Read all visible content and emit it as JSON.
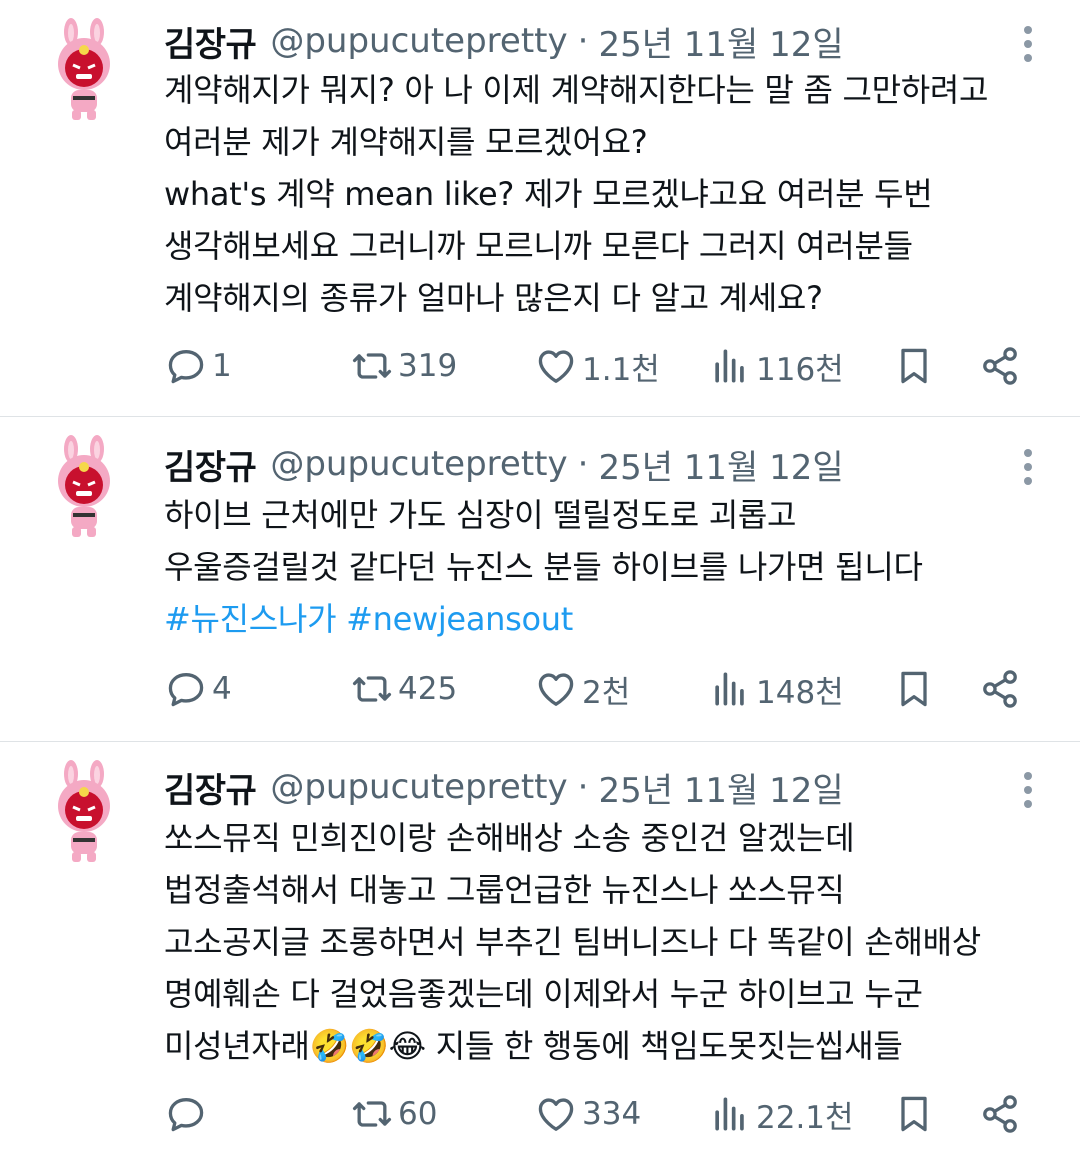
{
  "tweets": [
    {
      "name": "김장규",
      "handle": "@pupucutepretty",
      "separator": "·",
      "date": "25년 11월 12일",
      "lines": [
        "계약해지가 뭐지? 아 나 이제 계약해지한다는 말 좀 그만하려고",
        "여러분 제가 계약해지를 모르겠어요?",
        "what's 계약 mean like? 제가 모르겠냐고요 여러분 두번",
        "생각해보세요 그러니까 모르니까 모른다 그러지 여러분들",
        "계약해지의 종류가 얼마나 많은지 다 알고 계세요?"
      ],
      "stats": {
        "replies": "1",
        "retweets": "319",
        "likes": "1.1천",
        "views": "116천"
      }
    },
    {
      "name": "김장규",
      "handle": "@pupucutepretty",
      "separator": "·",
      "date": "25년 11월 12일",
      "lines": [
        "하이브 근처에만 가도 심장이 떨릴정도로 괴롭고",
        "우울증걸릴것 같다던 뉴진스 분들 하이브를 나가면 됩니다"
      ],
      "hashtags": "#뉴진스나가 #newjeansout",
      "stats": {
        "replies": "4",
        "retweets": "425",
        "likes": "2천",
        "views": "148천"
      }
    },
    {
      "name": "김장규",
      "handle": "@pupucutepretty",
      "separator": "·",
      "date": "25년 11월 12일",
      "lines": [
        "쏘스뮤직 민희진이랑 손해배상 소송 중인건 알겠는데",
        "법정출석해서 대놓고 그룹언급한 뉴진스나 쏘스뮤직",
        "고소공지글 조롱하면서 부추긴 팀버니즈나 다 똑같이 손해배상",
        "명예훼손 다 걸었음좋겠는데 이제와서 누군 하이브고 누군",
        "미성년자래🤣🤣😂 지들 한 행동에 책임도못짓는씹새들"
      ],
      "stats": {
        "replies": "",
        "retweets": "60",
        "likes": "334",
        "views": "22.1천"
      }
    }
  ],
  "colors": {
    "text": "#0f1419",
    "muted": "#536471",
    "link": "#1d9bf0",
    "divider": "#dfe3e6",
    "avatar": "#f2a7c3"
  },
  "icons": [
    "reply-icon",
    "retweet-icon",
    "like-icon",
    "views-icon",
    "bookmark-icon",
    "share-icon",
    "more-icon"
  ]
}
